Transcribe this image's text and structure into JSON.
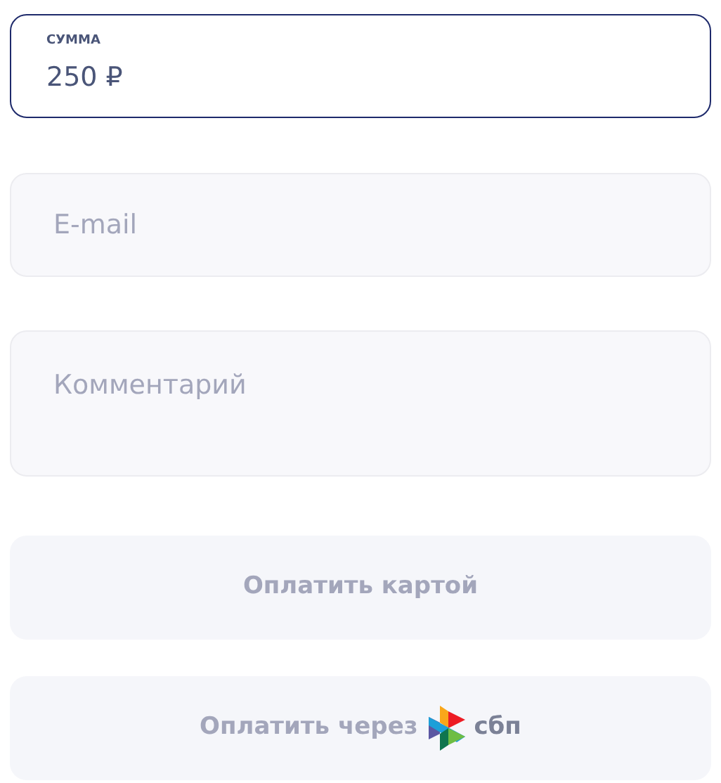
{
  "amount_field": {
    "label": "СУММА",
    "value": "250 ₽",
    "focused": true
  },
  "email_field": {
    "placeholder": "E-mail"
  },
  "comment_field": {
    "placeholder": "Комментарий"
  },
  "buttons": [
    {
      "kind": "card",
      "label": "Оплатить картой"
    },
    {
      "kind": "sbp",
      "label": "Оплатить через",
      "logo_text": "сбп"
    }
  ]
}
